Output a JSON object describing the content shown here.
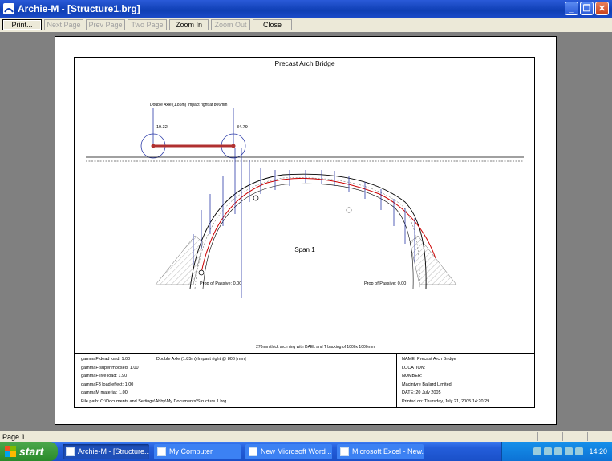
{
  "window": {
    "title": "Archie-M - [Structure1.brg]"
  },
  "toolbar": [
    {
      "label": "Print...",
      "enabled": true,
      "name": "print-button"
    },
    {
      "label": "Next Page",
      "enabled": false,
      "name": "next-page-button"
    },
    {
      "label": "Prev Page",
      "enabled": false,
      "name": "prev-page-button"
    },
    {
      "label": "Two Page",
      "enabled": false,
      "name": "two-page-button"
    },
    {
      "label": "Zoom In",
      "enabled": true,
      "name": "zoom-in-button"
    },
    {
      "label": "Zoom Out",
      "enabled": false,
      "name": "zoom-out-button"
    },
    {
      "label": "Close",
      "enabled": true,
      "name": "close-preview-button"
    }
  ],
  "drawing": {
    "title": "Precast Arch Bridge",
    "axle_label": "Double Axle (1.85m) Impact right at 806mm",
    "load_left": "19.32",
    "load_right": "34.79",
    "span_label": "Span 1",
    "prop_left": "Prop of Passive: 0.00",
    "prop_right": "Prop of Passive: 0.00",
    "caption": "270mm thick arch ring with DAEL and T backing of 1000x 1000mm"
  },
  "info_left": {
    "lines": [
      "gammaF dead load: 1.00",
      "gammaF superimposed: 1.00",
      "gammaF live load: 1.90",
      "gammaF3 load effect: 1.00",
      "gammaM material: 1.00",
      "File path: C:\\Documents and Settings\\Abby\\My Documents\\Structure 1.brg"
    ],
    "impact": "Double Axle (1.85m) Impact right @ 806 [mm]"
  },
  "info_right": {
    "lines": [
      "NAME: Precast Arch Bridge",
      "LOCATION:",
      "NUMBER:",
      "Macintyre Ballard Limited",
      "DATE: 20 July 2005",
      "Printed on: Thursday, July 21, 2005 14:20:29"
    ]
  },
  "statusbar": {
    "text": "Page 1"
  },
  "taskbar": {
    "start": "start",
    "tasks": [
      {
        "label": "Archie-M - [Structure...",
        "active": true
      },
      {
        "label": "My Computer",
        "active": false
      },
      {
        "label": "New Microsoft Word ...",
        "active": false
      },
      {
        "label": "Microsoft Excel - New...",
        "active": false
      }
    ],
    "clock": "14:20"
  },
  "colors": {
    "title_bar": "#0f3fb4",
    "arch_thrust": "#cc0000",
    "load_arrows": "#2b3aa8"
  }
}
